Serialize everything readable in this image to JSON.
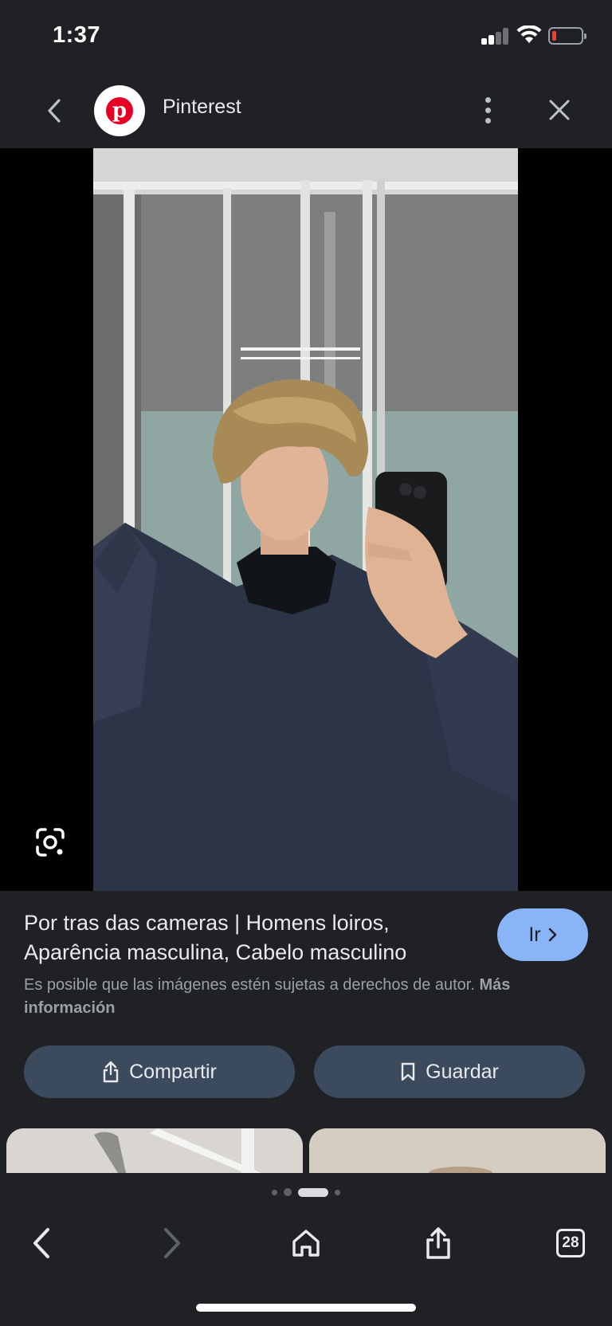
{
  "status_bar": {
    "time": "1:37",
    "battery_level": 0.15,
    "battery_color": "#ff3b30"
  },
  "header": {
    "site_name": "Pinterest",
    "logo_letter": "p",
    "logo_color": "#e60023",
    "back_icon": "chevron-left-icon",
    "more_icon": "more-vertical-icon",
    "close_icon": "close-icon"
  },
  "viewer": {
    "lens_icon": "google-lens-icon"
  },
  "result": {
    "title": "Por tras das cameras | Homens loiros, Aparência masculina, Cabelo masculino",
    "go_label": "Ir",
    "copyright_text": "Es posible que las imágenes estén sujetas a derechos de autor.",
    "more_info_label": "Más información",
    "accent_color": "#8ab4f8"
  },
  "actions": {
    "share_label": "Compartir",
    "save_label": "Guardar"
  },
  "pager": {
    "active_index": 2,
    "count": 4
  },
  "toolbar": {
    "tabs_count": "28"
  }
}
